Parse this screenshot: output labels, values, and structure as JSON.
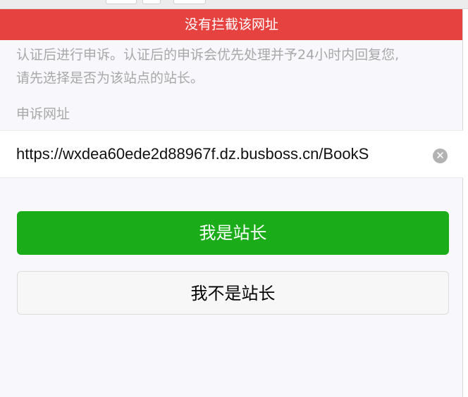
{
  "banner": {
    "title": "没有拦截该网址"
  },
  "description": {
    "line1": "认证后进行申诉。认证后的申诉会优先处理并予24小时内回复您,",
    "line2": "请先选择是否为该站点的站长。"
  },
  "url_section": {
    "label": "申诉网址",
    "value": "https://wxdea60ede2d88967f.dz.busboss.cn/BookS",
    "clear_glyph": "✕"
  },
  "actions": {
    "owner_button": "我是站长",
    "not_owner_button": "我不是站长"
  },
  "colors": {
    "banner": "#e64340",
    "primary": "#1aad19",
    "secondary_bg": "#f7f7f7",
    "muted_text": "#a8a8a8"
  }
}
